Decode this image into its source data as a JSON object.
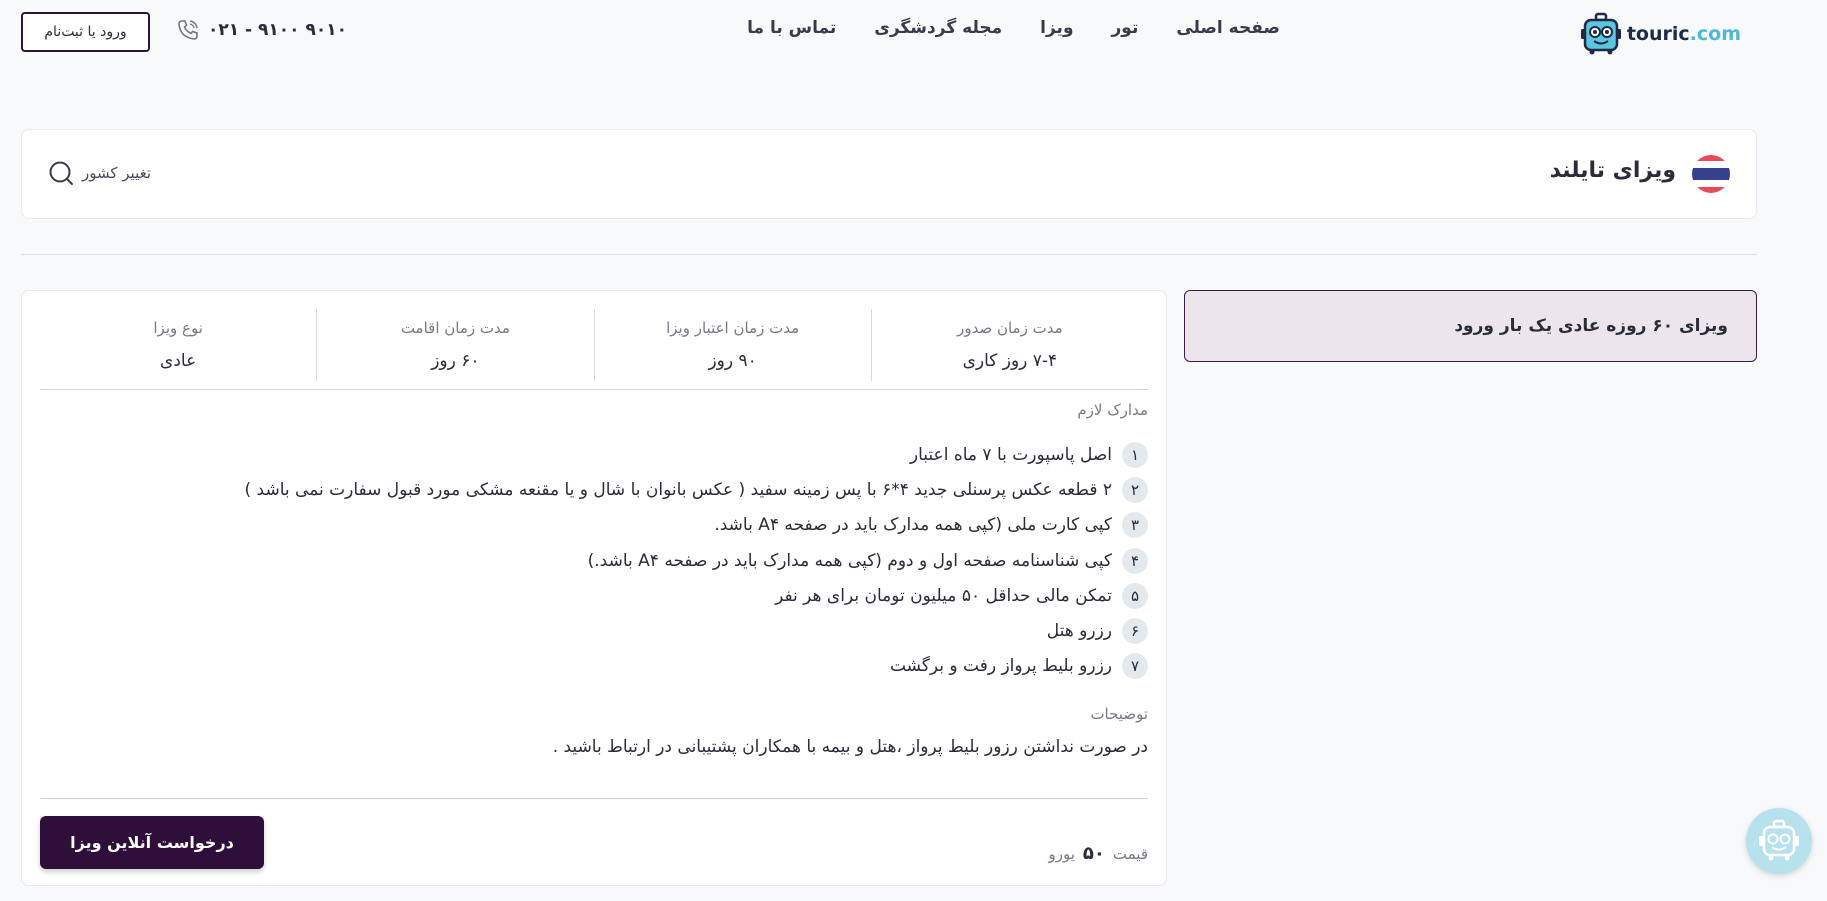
{
  "header": {
    "logo_name": "touric",
    "logo_tld": ".com",
    "nav": [
      {
        "label": "صفحه اصلی"
      },
      {
        "label": "تور"
      },
      {
        "label": "ویزا"
      },
      {
        "label": "مجله گردشگری"
      },
      {
        "label": "تماس با ما"
      }
    ],
    "phone": "۰۲۱ - ۹۱۰۰ ۹۰۱۰",
    "login_label": "ورود یا ثبت‌نام",
    "icons": {
      "logo": "robot-suitcase-icon",
      "phone": "phone-icon"
    }
  },
  "country": {
    "title": "ویزای تایلند",
    "change_label": "تغییر کشور",
    "flag_colors": [
      "#e84a5a",
      "#ffffff",
      "#34418c",
      "#ffffff",
      "#e84a5a"
    ],
    "icons": {
      "flag": "thailand-flag-icon",
      "search": "search-icon"
    }
  },
  "visa_tab": {
    "label": "ویزای ۶۰ روزه عادی یک بار ورود"
  },
  "stats": [
    {
      "label": "مدت زمان صدور",
      "value": "۷-۴ روز کاری"
    },
    {
      "label": "مدت زمان اعتبار ویزا",
      "value": "۹۰ روز"
    },
    {
      "label": "مدت زمان اقامت",
      "value": "۶۰ روز"
    },
    {
      "label": "نوع ویزا",
      "value": "عادی"
    }
  ],
  "documents": {
    "label": "مدارک لازم",
    "items": [
      {
        "num": "۱",
        "text": "اصل پاسپورت با ۷ ماه اعتبار"
      },
      {
        "num": "۲",
        "text": "۲ قطعه عکس پرسنلی جدید ۴*۶ با پس زمینه سفید ( عکس بانوان با شال و یا مقنعه مشکی مورد قبول سفارت نمی باشد )"
      },
      {
        "num": "۳",
        "text": "کپی کارت ملی (کپی همه مدارک باید در صفحه A۴ باشد."
      },
      {
        "num": "۴",
        "text": "کپی شناسنامه صفحه اول و دوم (کپی همه مدارک باید در صفحه A۴ باشد.)"
      },
      {
        "num": "۵",
        "text": "تمکن مالی حداقل ۵۰ میلیون تومان برای هر نفر"
      },
      {
        "num": "۶",
        "text": "رزرو هتل"
      },
      {
        "num": "۷",
        "text": "رزرو بلیط پرواز رفت و برگشت"
      }
    ]
  },
  "notes": {
    "label": "توضیحات",
    "text": "در صورت نداشتن رزور بلیط پرواز ،هتل و بیمه با همکاران پشتیبانی در ارتباط باشید ."
  },
  "price": {
    "label": "قیمت",
    "value": "۵۰",
    "unit": "یورو"
  },
  "request_button": "درخواست آنلاین ویزا",
  "chat_icon": "support-robot-icon",
  "colors": {
    "primary": "#2d0f3a",
    "tab_bg": "#ece6ec",
    "accent": "#4cb8d8"
  }
}
